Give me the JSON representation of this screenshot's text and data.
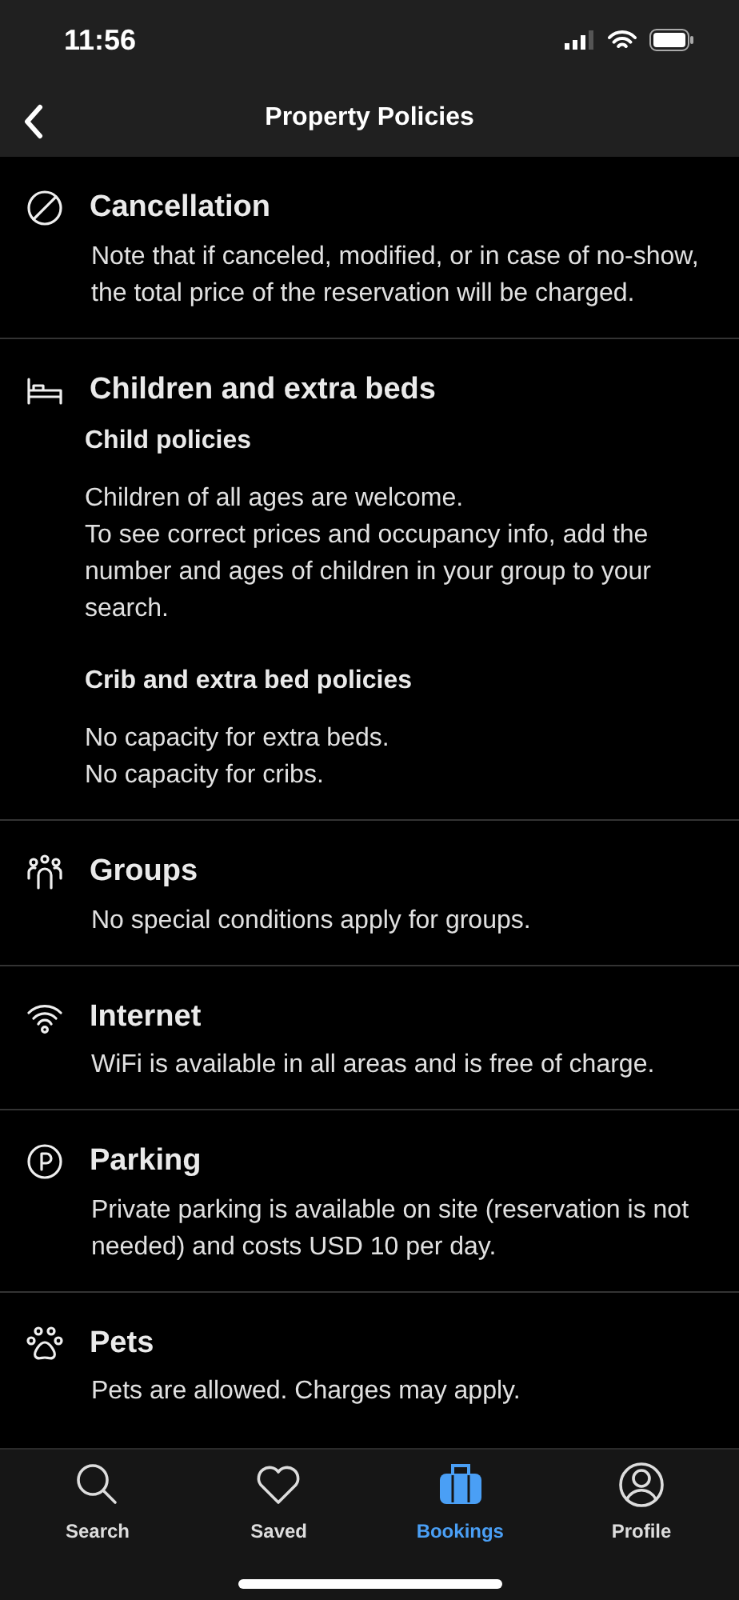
{
  "status_bar": {
    "time": "11:56"
  },
  "nav": {
    "title": "Property Policies"
  },
  "sections": [
    {
      "kind": "cancellation",
      "title": "Cancellation",
      "blocks": [
        {
          "lines": [
            "Note that if canceled, modified, or in case of no-show, the total price of the reservation will be charged."
          ]
        }
      ]
    },
    {
      "kind": "beds",
      "title": "Children and extra beds",
      "blocks": [
        {
          "heading": "Child policies",
          "lines": [
            "Children of all ages are welcome.",
            "To see correct prices and occupancy info, add the number and ages of children in your group to your search."
          ]
        },
        {
          "heading": "Crib and extra bed policies",
          "lines": [
            "No capacity for extra beds.",
            "No capacity for cribs."
          ]
        }
      ]
    },
    {
      "kind": "groups",
      "title": "Groups",
      "blocks": [
        {
          "lines": [
            "No special conditions apply for groups."
          ]
        }
      ]
    },
    {
      "kind": "internet",
      "title": "Internet",
      "blocks": [
        {
          "lines": [
            "WiFi is available in all areas and is free of charge."
          ]
        }
      ]
    },
    {
      "kind": "parking",
      "title": "Parking",
      "blocks": [
        {
          "lines": [
            "Private parking is available on site (reservation is not needed) and costs USD 10 per day."
          ]
        }
      ]
    },
    {
      "kind": "pets",
      "title": "Pets",
      "blocks": [
        {
          "lines": [
            "Pets are allowed. Charges may apply."
          ]
        }
      ]
    }
  ],
  "tab_bar": [
    {
      "kind": "search",
      "label": "Search",
      "selected": false
    },
    {
      "kind": "saved",
      "label": "Saved",
      "selected": false
    },
    {
      "kind": "bookings",
      "label": "Bookings",
      "selected": true
    },
    {
      "kind": "profile",
      "label": "Profile",
      "selected": false
    }
  ]
}
